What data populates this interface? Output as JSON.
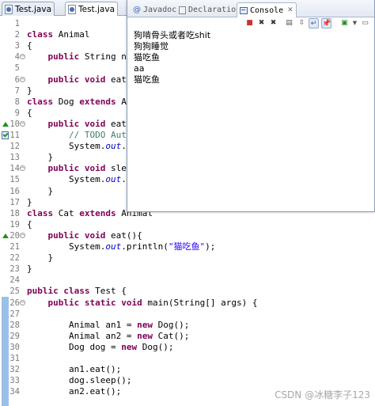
{
  "editor_tabs": [
    {
      "label": "Test.java",
      "active": false
    },
    {
      "label": "Test.java",
      "active": true
    }
  ],
  "code_lines": [
    {
      "num": "1",
      "html": ""
    },
    {
      "num": "2",
      "html": "<span class=\"kw\">class</span> Animal"
    },
    {
      "num": "3",
      "html": "{"
    },
    {
      "num": "4",
      "html": "    <span class=\"kw\">public</span> String n"
    },
    {
      "num": "5",
      "html": ""
    },
    {
      "num": "6",
      "html": "    <span class=\"kw\">public</span> <span class=\"kw\">void</span> eat"
    },
    {
      "num": "7",
      "html": "}"
    },
    {
      "num": "8",
      "html": "<span class=\"kw\">class</span> Dog <span class=\"kw\">extends</span> A"
    },
    {
      "num": "9",
      "html": "{"
    },
    {
      "num": "10",
      "html": "    <span class=\"kw\">public</span> <span class=\"kw\">void</span> eat"
    },
    {
      "num": "11",
      "html": "        <span class=\"cm\">// TODO Aut</span>"
    },
    {
      "num": "12",
      "html": "        System.<span class=\"fi\">out</span>."
    },
    {
      "num": "13",
      "html": "    }"
    },
    {
      "num": "14",
      "html": "    <span class=\"kw\">public</span> <span class=\"kw\">void</span> sle"
    },
    {
      "num": "15",
      "html": "        System.<span class=\"fi\">out</span>."
    },
    {
      "num": "16",
      "html": "    }"
    },
    {
      "num": "17",
      "html": "}"
    },
    {
      "num": "18",
      "html": "<span class=\"kw\">class</span> Cat <span class=\"kw\">extends</span> Animal"
    },
    {
      "num": "19",
      "html": "{"
    },
    {
      "num": "20",
      "html": "    <span class=\"kw\">public</span> <span class=\"kw\">void</span> eat(){"
    },
    {
      "num": "21",
      "html": "        System.<span class=\"fi\">out</span>.println(<span class=\"st\">\"猫吃鱼\"</span>);"
    },
    {
      "num": "22",
      "html": "    }"
    },
    {
      "num": "23",
      "html": "}"
    },
    {
      "num": "24",
      "html": ""
    },
    {
      "num": "25",
      "html": "<span class=\"kw\">public</span> <span class=\"kw\">class</span> Test {"
    },
    {
      "num": "26",
      "html": "    <span class=\"kw\">public</span> <span class=\"kw\">static</span> <span class=\"kw\">void</span> main(String[] args) {"
    },
    {
      "num": "27",
      "html": ""
    },
    {
      "num": "28",
      "html": "        Animal an1 = <span class=\"kw\">new</span> Dog();"
    },
    {
      "num": "29",
      "html": "        Animal an2 = <span class=\"kw\">new</span> Cat();"
    },
    {
      "num": "30",
      "html": "        Dog dog = <span class=\"kw\">new</span> Dog();"
    },
    {
      "num": "31",
      "html": ""
    },
    {
      "num": "32",
      "html": "        an1.eat();"
    },
    {
      "num": "33",
      "html": "        dog.sleep();"
    },
    {
      "num": "34",
      "html": "        an2.eat();"
    }
  ],
  "view_tabs": [
    {
      "label": "Javadoc",
      "icon": "javadoc-icon",
      "active": false
    },
    {
      "label": "Declaration",
      "icon": "declaration-icon",
      "active": false
    },
    {
      "label": "Console",
      "icon": "console-icon",
      "active": true
    }
  ],
  "console_output": [
    "狗啃骨头或者吃shit",
    "狗狗睡觉",
    "猫吃鱼",
    "aa",
    "猫吃鱼"
  ],
  "watermark": "CSDN @冰糖李子123",
  "colors": {
    "keyword": "#7f0055",
    "comment": "#3f7f5f",
    "string": "#2a00ff",
    "field": "#0000c0"
  }
}
